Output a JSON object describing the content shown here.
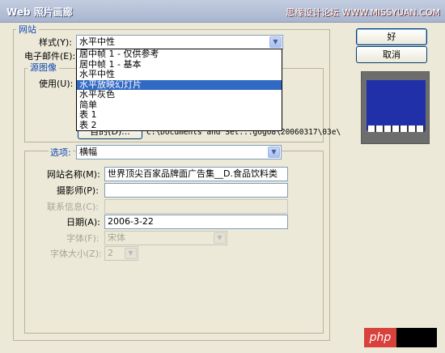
{
  "window": {
    "title": "Web 照片画廊",
    "watermark": "思缘设计论坛 WWW.MISSYUAN.COM"
  },
  "site": {
    "legend": "网站",
    "style_label": "样式(Y):",
    "style_value": "水平中性",
    "email_label": "电子邮件(E):",
    "style_options": [
      "居中帧 1 - 仅供参考",
      "居中帧 1 - 基本",
      "水平中性",
      "水平放映幻灯片",
      "水平灰色",
      "简单",
      "表 1",
      "表 2"
    ],
    "highlighted_option": "水平放映幻灯片"
  },
  "source": {
    "legend": "源图像",
    "use_label": "使用(U):",
    "browse_label": "目的(D)...",
    "path": "C:\\Documents and Set...gogo8\\20060317\\03e\\"
  },
  "options": {
    "label": "选项:",
    "value": "横幅",
    "site_name_label": "网站名称(M):",
    "site_name_value": "世界顶尖百家品牌面广告集__D.食品饮料类",
    "photographer_label": "摄影师(P):",
    "photographer_value": "",
    "contact_label": "联系信息(C):",
    "contact_value": "",
    "date_label": "日期(A):",
    "date_value": "2006-3-22",
    "font_label": "字体(F):",
    "font_value": "宋体",
    "font_size_label": "字体大小(Z):",
    "font_size_value": "2"
  },
  "buttons": {
    "ok": "好",
    "cancel": "取消"
  },
  "badge": {
    "text": "php"
  }
}
